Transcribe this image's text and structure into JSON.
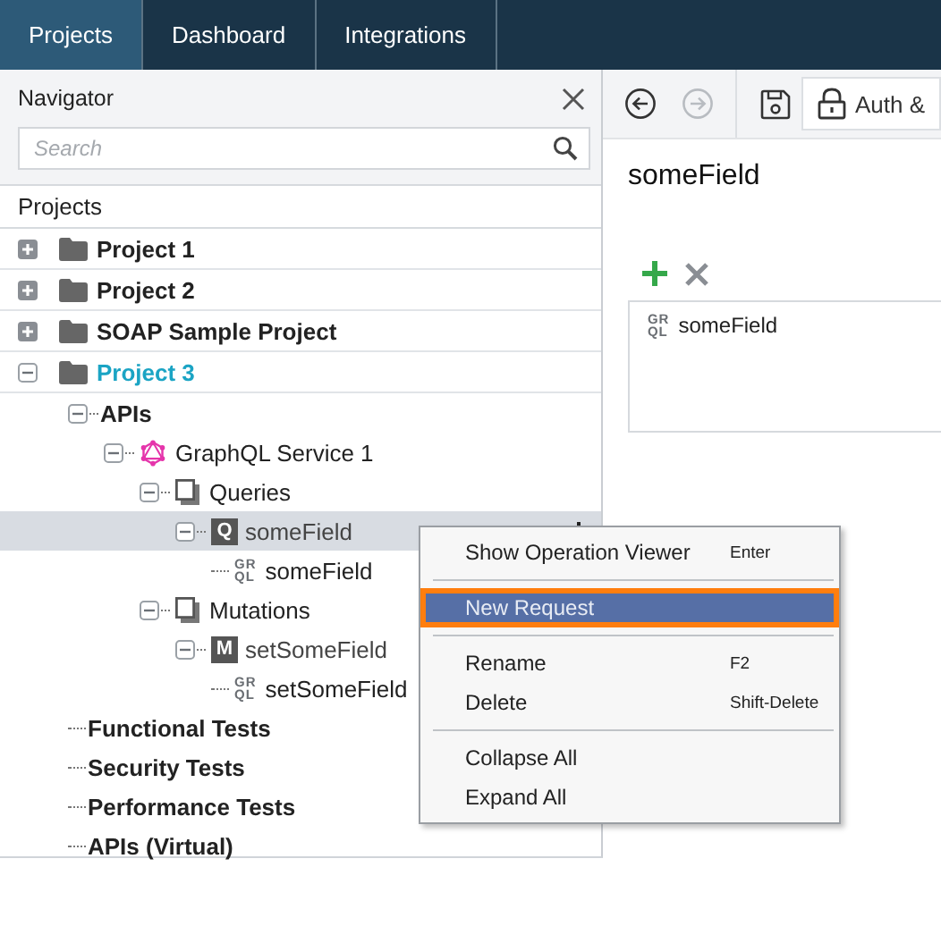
{
  "tabs": [
    {
      "label": "Projects",
      "selected": true
    },
    {
      "label": "Dashboard",
      "selected": false
    },
    {
      "label": "Integrations",
      "selected": false
    }
  ],
  "navigator": {
    "title": "Navigator",
    "search": {
      "placeholder": "Search"
    },
    "section": "Projects",
    "tree": [
      {
        "kind": "project",
        "label": "Project 1",
        "expanded": false,
        "current": false,
        "selected": false
      },
      {
        "kind": "project",
        "label": "Project 2",
        "expanded": false,
        "current": false,
        "selected": false
      },
      {
        "kind": "project",
        "label": "SOAP Sample Project",
        "expanded": false,
        "current": false,
        "selected": false
      },
      {
        "kind": "project",
        "label": "Project 3",
        "expanded": true,
        "current": true,
        "selected": false,
        "children": [
          {
            "kind": "group",
            "label": "APIs",
            "expanded": true,
            "selected": false,
            "children": [
              {
                "kind": "service",
                "label": "GraphQL Service 1",
                "expanded": true,
                "selected": false,
                "children": [
                  {
                    "kind": "folder",
                    "label": "Queries",
                    "expanded": true,
                    "selected": false,
                    "children": [
                      {
                        "kind": "operation",
                        "badge": "Q",
                        "label": "someField",
                        "expanded": true,
                        "selected": true,
                        "children": [
                          {
                            "kind": "request",
                            "badge": [
                              "GR",
                              "QL"
                            ],
                            "label": "someField",
                            "selected": false
                          }
                        ]
                      }
                    ]
                  },
                  {
                    "kind": "folder",
                    "label": "Mutations",
                    "expanded": true,
                    "selected": false,
                    "children": [
                      {
                        "kind": "operation",
                        "badge": "M",
                        "label": "setSomeField",
                        "expanded": true,
                        "selected": false,
                        "children": [
                          {
                            "kind": "request",
                            "badge": [
                              "GR",
                              "QL"
                            ],
                            "label": "setSomeField",
                            "selected": false
                          }
                        ]
                      }
                    ]
                  }
                ]
              }
            ]
          },
          {
            "kind": "group",
            "label": "Functional Tests",
            "selected": false
          },
          {
            "kind": "group",
            "label": "Security Tests",
            "selected": false
          },
          {
            "kind": "group",
            "label": "Performance Tests",
            "selected": false
          },
          {
            "kind": "group",
            "label": "APIs (Virtual)",
            "selected": false
          }
        ]
      }
    ]
  },
  "toolbar": {
    "nav": [
      {
        "kind": "back",
        "disabled": false
      },
      {
        "kind": "forward",
        "disabled": true
      }
    ],
    "auth": "Auth &"
  },
  "editor": {
    "title": "someField",
    "requests": [
      {
        "badge": [
          "GR",
          "QL"
        ],
        "label": "someField"
      }
    ]
  },
  "context_menu": [
    {
      "kind": "item",
      "label": "Show Operation Viewer",
      "shortcut": "Enter",
      "selected": false
    },
    {
      "kind": "separator"
    },
    {
      "kind": "item",
      "label": "New Request",
      "selected": true
    },
    {
      "kind": "separator"
    },
    {
      "kind": "item",
      "label": "Rename",
      "shortcut": "F2",
      "selected": false
    },
    {
      "kind": "item",
      "label": "Delete",
      "shortcut": "Shift-Delete",
      "selected": false
    },
    {
      "kind": "separator"
    },
    {
      "kind": "item",
      "label": "Collapse All",
      "selected": false
    },
    {
      "kind": "item",
      "label": "Expand All",
      "selected": false
    }
  ]
}
